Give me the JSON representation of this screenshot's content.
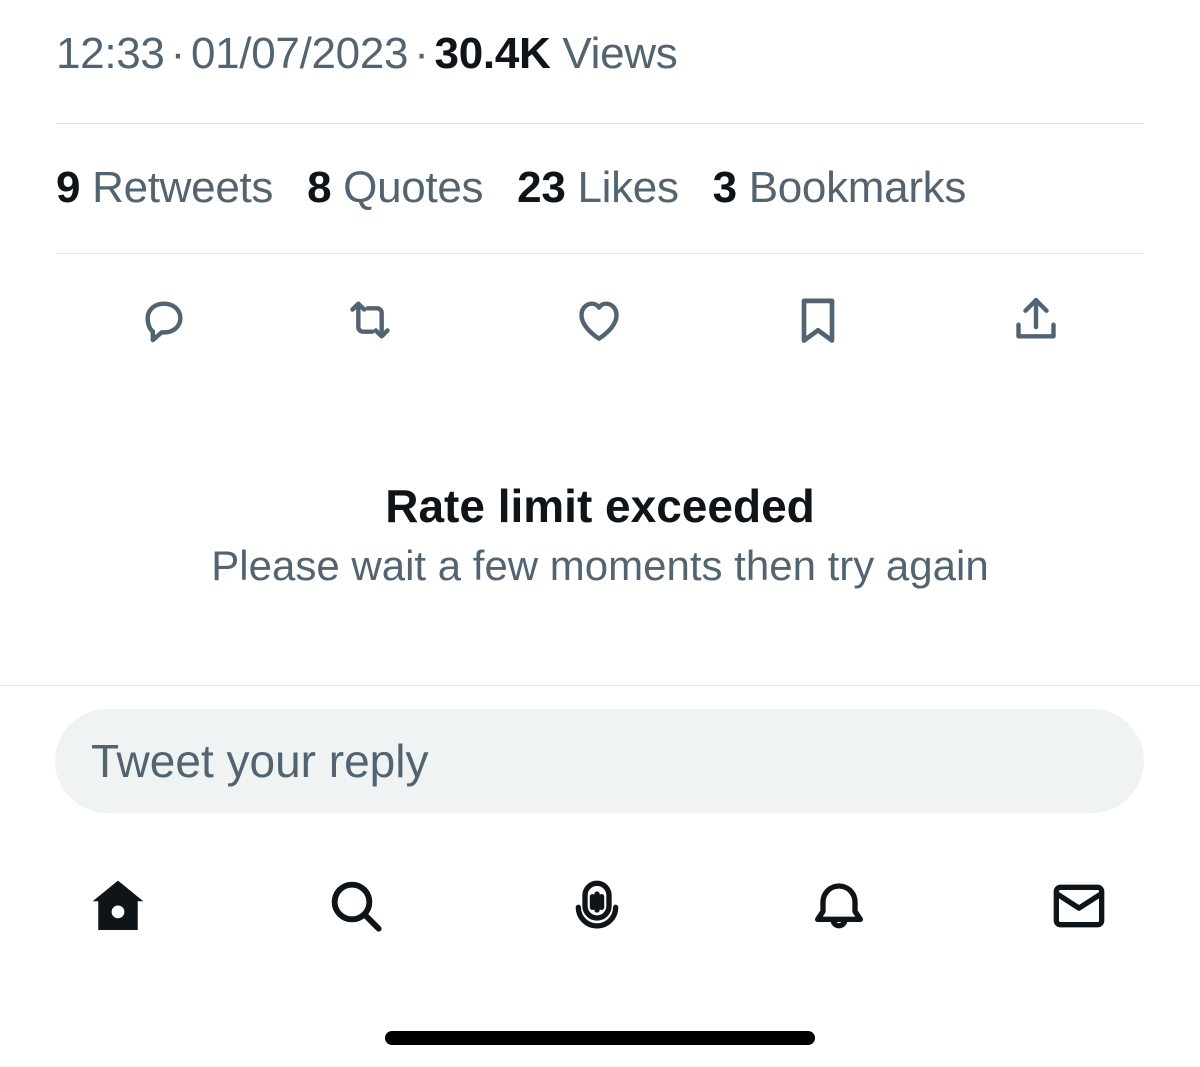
{
  "meta": {
    "time": "12:33",
    "date": "01/07/2023",
    "views_count": "30.4K",
    "views_label": "Views",
    "separator": "·"
  },
  "stats": [
    {
      "count": "9",
      "label": "Retweets"
    },
    {
      "count": "8",
      "label": "Quotes"
    },
    {
      "count": "23",
      "label": "Likes"
    },
    {
      "count": "3",
      "label": "Bookmarks"
    }
  ],
  "actions": [
    "reply-icon",
    "retweet-icon",
    "like-icon",
    "bookmark-icon",
    "share-icon"
  ],
  "error": {
    "title": "Rate limit exceeded",
    "message": "Please wait a few moments then try again"
  },
  "reply": {
    "placeholder": "Tweet your reply"
  },
  "tabs": [
    "home-icon",
    "search-icon",
    "spaces-icon",
    "notifications-icon",
    "messages-icon"
  ],
  "colors": {
    "text_primary": "#0f1419",
    "text_secondary": "#536471",
    "divider": "#dfe3e7",
    "input_bg": "#eff3f4"
  }
}
